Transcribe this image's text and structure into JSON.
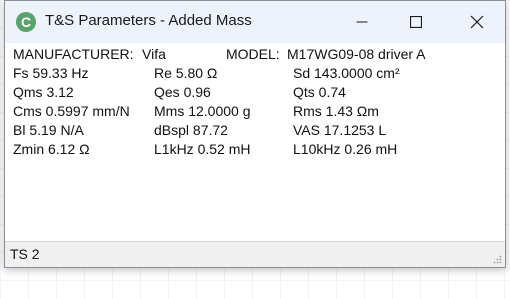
{
  "window": {
    "title": "T&S Parameters - Added Mass",
    "app_icon_letter": "C",
    "icon_color": "#5aa36a"
  },
  "controls": {
    "minimize_glyph": "—",
    "maximize_icon": "square-outline",
    "close_icon": "x"
  },
  "header": {
    "manufacturer_label": "MANUFACTURER:",
    "manufacturer_value": "Vifa",
    "model_label": "MODEL:",
    "model_value": "M17WG09-08 driver A"
  },
  "params": [
    [
      "Fs  59.33 Hz",
      "Re  5.80 Ω",
      "Sd  143.0000 cm²"
    ],
    [
      "Qms 3.12",
      "Qes 0.96",
      "Qts 0.74"
    ],
    [
      "Cms 0.5997 mm/N",
      "Mms 12.0000 g",
      "Rms 1.43 Ωm"
    ],
    [
      "Bl  5.19 N/A",
      "dBspl 87.72",
      "VAS  17.1253 L"
    ],
    [
      "Zmin  6.12 Ω",
      "L1kHz  0.52 mH",
      "L10kHz 0.26 mH"
    ]
  ],
  "status": {
    "text": "TS 2"
  }
}
